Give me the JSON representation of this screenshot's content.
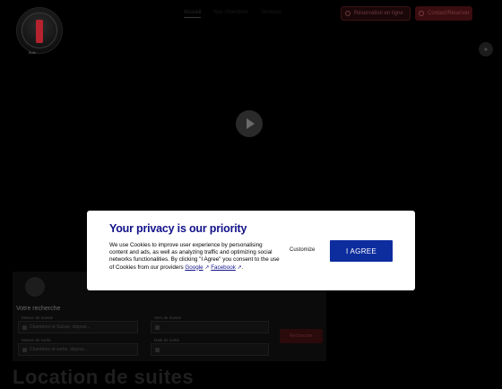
{
  "header": {
    "logo_caption": "Buis",
    "nav": [
      "Accueil",
      "Nos chambres",
      "Services"
    ],
    "btn_outline": "Réservation en ligne",
    "btn_filled": "Contact/Réserver"
  },
  "search_panel": {
    "title": "Votre recherche",
    "fields": [
      {
        "label": "Moteur de Suisse",
        "value": "Chambres et Suisse, disposi..."
      },
      {
        "label": "Vers de Suisse",
        "value": ""
      },
      {
        "label": "Moteur de sortie",
        "value": "Chambres et sortie, disposi..."
      },
      {
        "label": "Date de sortie",
        "value": ""
      }
    ],
    "button": "Rechercher"
  },
  "big_title": "Location de suites",
  "consent": {
    "title": "Your privacy is our priority",
    "body_before": "We use Cookies to improve user experience by personalising content and ads, as well as analyzing traffic and optimizing social networks functionalities. By clicking \"I Agree\" you consent to the use of Cookies from our providers ",
    "google": "Google",
    "facebook": "Facebook",
    "customize": "Customize",
    "agree": "I AGREE"
  },
  "colors": {
    "modal_title": "#12128a",
    "agree_bg": "#0d2d9e",
    "accent_red": "#b5232e"
  }
}
